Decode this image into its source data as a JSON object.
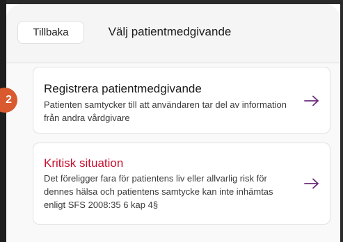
{
  "header": {
    "back_label": "Tillbaka",
    "title": "Välj patientmedgivande"
  },
  "options": [
    {
      "title": "Registrera patientmedgivande",
      "description": "Patienten samtycker till att användaren tar del av information från andra vårdgivare",
      "title_color": "#1a1a1a",
      "arrow_icon": "arrow-right-icon"
    },
    {
      "title": "Kritisk situation",
      "description": "Det föreligger fara för patientens liv eller allvarlig risk för dennes hälsa och patientens samtycke kan inte inhämtas enligt SFS 2008:35 6 kap 4§",
      "title_color": "#c8102e",
      "arrow_icon": "arrow-right-icon"
    }
  ],
  "badge": {
    "label": "2",
    "color": "#d95a2e"
  },
  "colors": {
    "arrow": "#6b2a7a",
    "accent_red": "#c8102e"
  }
}
